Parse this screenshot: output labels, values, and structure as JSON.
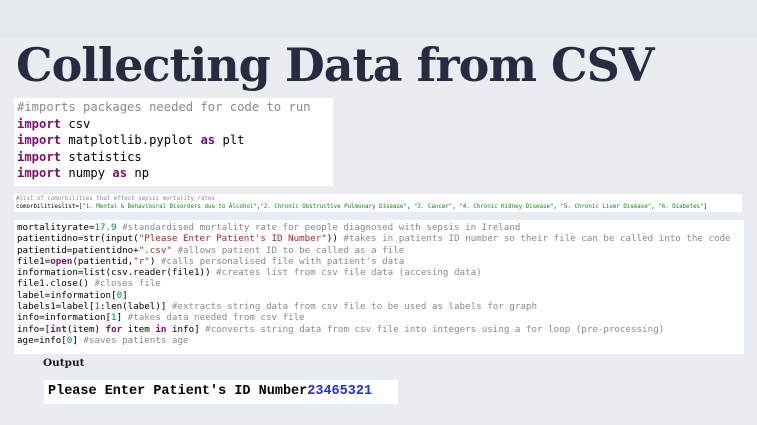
{
  "slide": {
    "title": "Collecting Data from CSV",
    "output_label": "Output"
  },
  "code_block_1": {
    "lines": [
      [
        {
          "t": "#imports packages needed for code to run",
          "c": "cm"
        }
      ],
      [
        {
          "t": "import",
          "c": "kw"
        },
        {
          "t": " csv",
          "c": ""
        }
      ],
      [
        {
          "t": "import",
          "c": "kw"
        },
        {
          "t": " matplotlib.pyplot ",
          "c": ""
        },
        {
          "t": "as",
          "c": "kw"
        },
        {
          "t": " plt",
          "c": ""
        }
      ],
      [
        {
          "t": "import",
          "c": "kw"
        },
        {
          "t": " statistics",
          "c": ""
        }
      ],
      [
        {
          "t": "import",
          "c": "kw"
        },
        {
          "t": " numpy ",
          "c": ""
        },
        {
          "t": "as",
          "c": "kw"
        },
        {
          "t": " np",
          "c": ""
        }
      ]
    ]
  },
  "code_block_2": {
    "lines": [
      [
        {
          "t": "#list of comorbilities that effect sepsis mortality rates",
          "c": "cm"
        }
      ],
      [
        {
          "t": "comorbilitieslist=[",
          "c": ""
        },
        {
          "t": "\"1. Mental & Behavioural Disorders due to Alcohol\"",
          "c": "gr"
        },
        {
          "t": ",",
          "c": ""
        },
        {
          "t": "\"2. Chronic Obstructive Pulmonary Disease\"",
          "c": "gr"
        },
        {
          "t": ", ",
          "c": ""
        },
        {
          "t": "\"3. Cancer\"",
          "c": "gr"
        },
        {
          "t": ", ",
          "c": ""
        },
        {
          "t": "\"4. Chronic Kidney Disease\"",
          "c": "gr"
        },
        {
          "t": ", ",
          "c": ""
        },
        {
          "t": "\"5. Chronic Liver Disease\"",
          "c": "gr"
        },
        {
          "t": ", ",
          "c": ""
        },
        {
          "t": "\"6. Diabetes\"",
          "c": "gr"
        },
        {
          "t": "]",
          "c": ""
        }
      ]
    ]
  },
  "code_block_3": {
    "lines": [
      [
        {
          "t": "mortalityrate=",
          "c": ""
        },
        {
          "t": "17.9",
          "c": "nm"
        },
        {
          "t": " #standardised mortality rate for people diagnosed with sepsis in Ireland",
          "c": "cm"
        }
      ],
      [
        {
          "t": "patientidno=str(input(",
          "c": ""
        },
        {
          "t": "\"Please Enter Patient's ID Number\"",
          "c": "st"
        },
        {
          "t": ")) ",
          "c": ""
        },
        {
          "t": "#takes in patients ID number so their file can be called into the code",
          "c": "cm"
        }
      ],
      [
        {
          "t": "patientid=patientidno+",
          "c": ""
        },
        {
          "t": "\".csv\"",
          "c": "st"
        },
        {
          "t": " #allows patient ID to be called as a file",
          "c": "cm"
        }
      ],
      [
        {
          "t": "file1=",
          "c": ""
        },
        {
          "t": "open",
          "c": "kw"
        },
        {
          "t": "(patientid,",
          "c": ""
        },
        {
          "t": "\"r\"",
          "c": "st"
        },
        {
          "t": ") ",
          "c": ""
        },
        {
          "t": "#calls personalised file with patient's data",
          "c": "cm"
        }
      ],
      [
        {
          "t": "information=list(csv.reader(file1)) ",
          "c": ""
        },
        {
          "t": "#creates list from csv file data (accesing data)",
          "c": "cm"
        }
      ],
      [
        {
          "t": "file1.close() ",
          "c": ""
        },
        {
          "t": "#closes file",
          "c": "cm"
        }
      ],
      [
        {
          "t": "label=information[",
          "c": ""
        },
        {
          "t": "0",
          "c": "nm"
        },
        {
          "t": "]",
          "c": ""
        }
      ],
      [
        {
          "t": "labels1=label[",
          "c": ""
        },
        {
          "t": "1",
          "c": "nm"
        },
        {
          "t": ":len(label)] ",
          "c": ""
        },
        {
          "t": "#extracts string data from csv file to be used as labels for graph",
          "c": "cm"
        }
      ],
      [
        {
          "t": "info=information[",
          "c": ""
        },
        {
          "t": "1",
          "c": "nm"
        },
        {
          "t": "] ",
          "c": ""
        },
        {
          "t": "#takes data needed from csv file",
          "c": "cm"
        }
      ],
      [
        {
          "t": "info=[",
          "c": ""
        },
        {
          "t": "int",
          "c": "kw"
        },
        {
          "t": "(item) ",
          "c": ""
        },
        {
          "t": "for",
          "c": "kw"
        },
        {
          "t": " item ",
          "c": ""
        },
        {
          "t": "in",
          "c": "kw"
        },
        {
          "t": " info] ",
          "c": ""
        },
        {
          "t": "#converts string data from csv file into integers using a for loop (pre-processing)",
          "c": "cm"
        }
      ],
      [
        {
          "t": "age=info[",
          "c": ""
        },
        {
          "t": "0",
          "c": "nm"
        },
        {
          "t": "] ",
          "c": ""
        },
        {
          "t": "#saves patients age",
          "c": "cm"
        }
      ]
    ]
  },
  "output": {
    "prompt": "Please Enter Patient's ID Number",
    "value": "23465321"
  }
}
